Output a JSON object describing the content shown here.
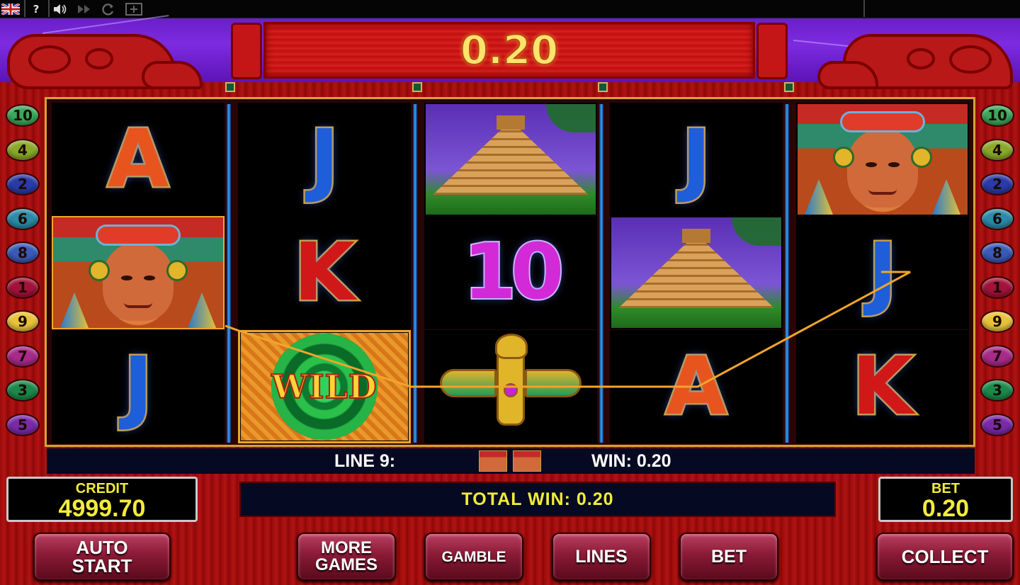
{
  "topbar": {
    "flag_icon": "uk-flag-icon",
    "help_label": "?",
    "sound_icon": "speaker-icon",
    "fast_icon": "fast-forward-icon",
    "refresh_icon": "refresh-icon",
    "fullscreen_icon": "window-icon"
  },
  "win_display": "0.20",
  "reels": [
    [
      {
        "symbol": "A",
        "kind": "letter"
      },
      {
        "symbol": "face",
        "kind": "face",
        "highlight": true
      },
      {
        "symbol": "J",
        "kind": "letter"
      }
    ],
    [
      {
        "symbol": "J",
        "kind": "letter"
      },
      {
        "symbol": "K",
        "kind": "letter"
      },
      {
        "symbol": "WILD",
        "kind": "wild",
        "highlight": true
      }
    ],
    [
      {
        "symbol": "pyramid",
        "kind": "pyramid"
      },
      {
        "symbol": "10",
        "kind": "letter"
      },
      {
        "symbol": "bird",
        "kind": "bird"
      }
    ],
    [
      {
        "symbol": "J",
        "kind": "letter"
      },
      {
        "symbol": "pyramid",
        "kind": "pyramid"
      },
      {
        "symbol": "A",
        "kind": "letter"
      }
    ],
    [
      {
        "symbol": "face",
        "kind": "face"
      },
      {
        "symbol": "J",
        "kind": "letter"
      },
      {
        "symbol": "K",
        "kind": "letter"
      }
    ]
  ],
  "paylines_left": [
    "10",
    "4",
    "2",
    "6",
    "8",
    "1",
    "9",
    "7",
    "3",
    "5"
  ],
  "paylines_right": [
    "10",
    "4",
    "2",
    "6",
    "8",
    "1",
    "9",
    "7",
    "3",
    "5"
  ],
  "payline_colors": {
    "1": "#a2123a",
    "2": "#2a3aa8",
    "3": "#1a8a4a",
    "4": "#8aa82a",
    "5": "#7a2aa8",
    "6": "#2a8aa8",
    "7": "#a82a8a",
    "8": "#3a5ab8",
    "9": "#e8c23a",
    "10": "#3aa85a"
  },
  "info_strip": {
    "line_label": "LINE 9:",
    "win_label": "WIN: 0.20"
  },
  "credit": {
    "label": "CREDIT",
    "value": "4999.70"
  },
  "total_win": "TOTAL WIN: 0.20",
  "bet": {
    "label": "BET",
    "value": "0.20"
  },
  "buttons": {
    "auto_start_line1": "AUTO",
    "auto_start_line2": "START",
    "more_games_line1": "MORE",
    "more_games_line2": "GAMES",
    "gamble": "GAMBLE",
    "lines": "LINES",
    "bet": "BET",
    "collect": "COLLECT"
  }
}
